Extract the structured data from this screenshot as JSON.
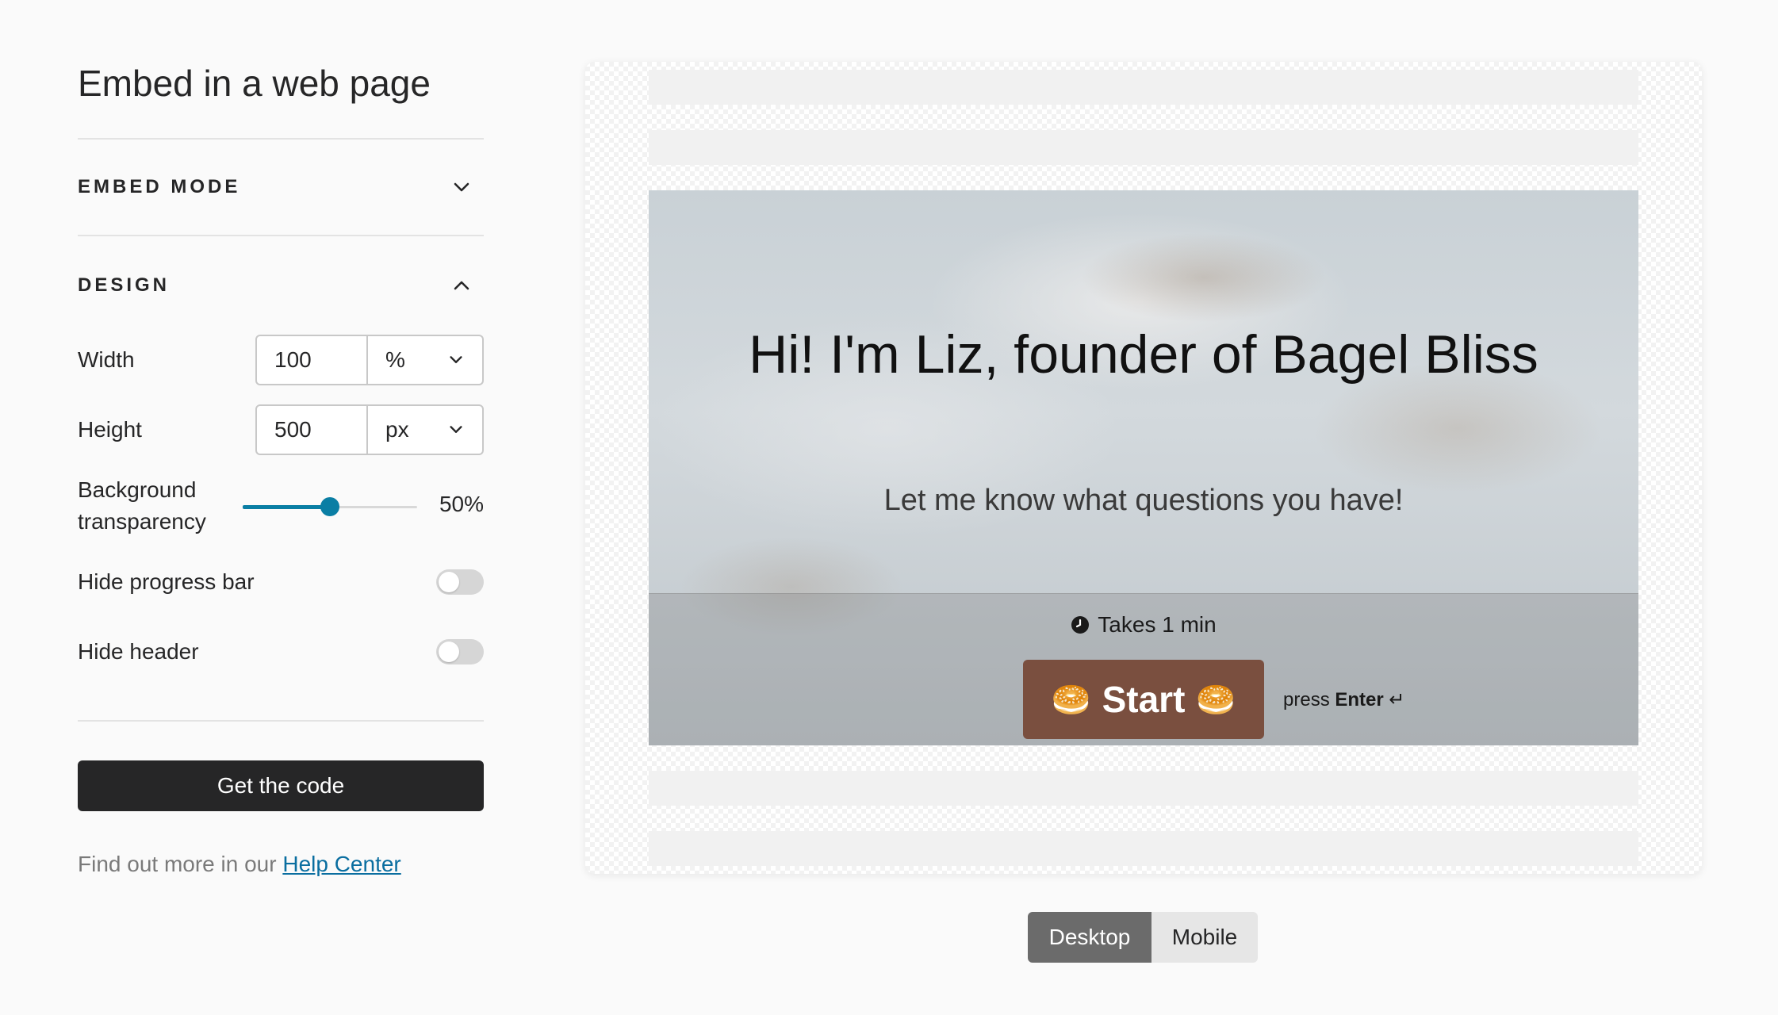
{
  "panel": {
    "title": "Embed in a web page",
    "embed_mode": {
      "label": "EMBED MODE",
      "expanded": false
    },
    "design": {
      "label": "DESIGN",
      "expanded": true,
      "width": {
        "label": "Width",
        "value": "100",
        "unit": "%"
      },
      "height": {
        "label": "Height",
        "value": "500",
        "unit": "px"
      },
      "transparency": {
        "label": "Background transparency",
        "value": 50,
        "display": "50%"
      },
      "hide_progress": {
        "label": "Hide progress bar",
        "on": false
      },
      "hide_header": {
        "label": "Hide header",
        "on": false
      }
    },
    "get_code_label": "Get the code",
    "help": {
      "prefix": "Find out more in our ",
      "link": "Help Center"
    }
  },
  "preview": {
    "title": "Hi! I'm Liz, founder of Bagel Bliss",
    "subtitle": "Let me know what questions you have!",
    "duration": "Takes 1 min",
    "start_label": "Start",
    "start_emoji": "🥯",
    "press_prefix": "press ",
    "press_key": "Enter",
    "press_symbol": "↵"
  },
  "device": {
    "desktop": "Desktop",
    "mobile": "Mobile",
    "selected": "Desktop"
  },
  "colors": {
    "accent": "#0a7ea4",
    "button_dark": "#262627",
    "start_button": "#7a4f3f",
    "link": "#0a6ea0"
  }
}
